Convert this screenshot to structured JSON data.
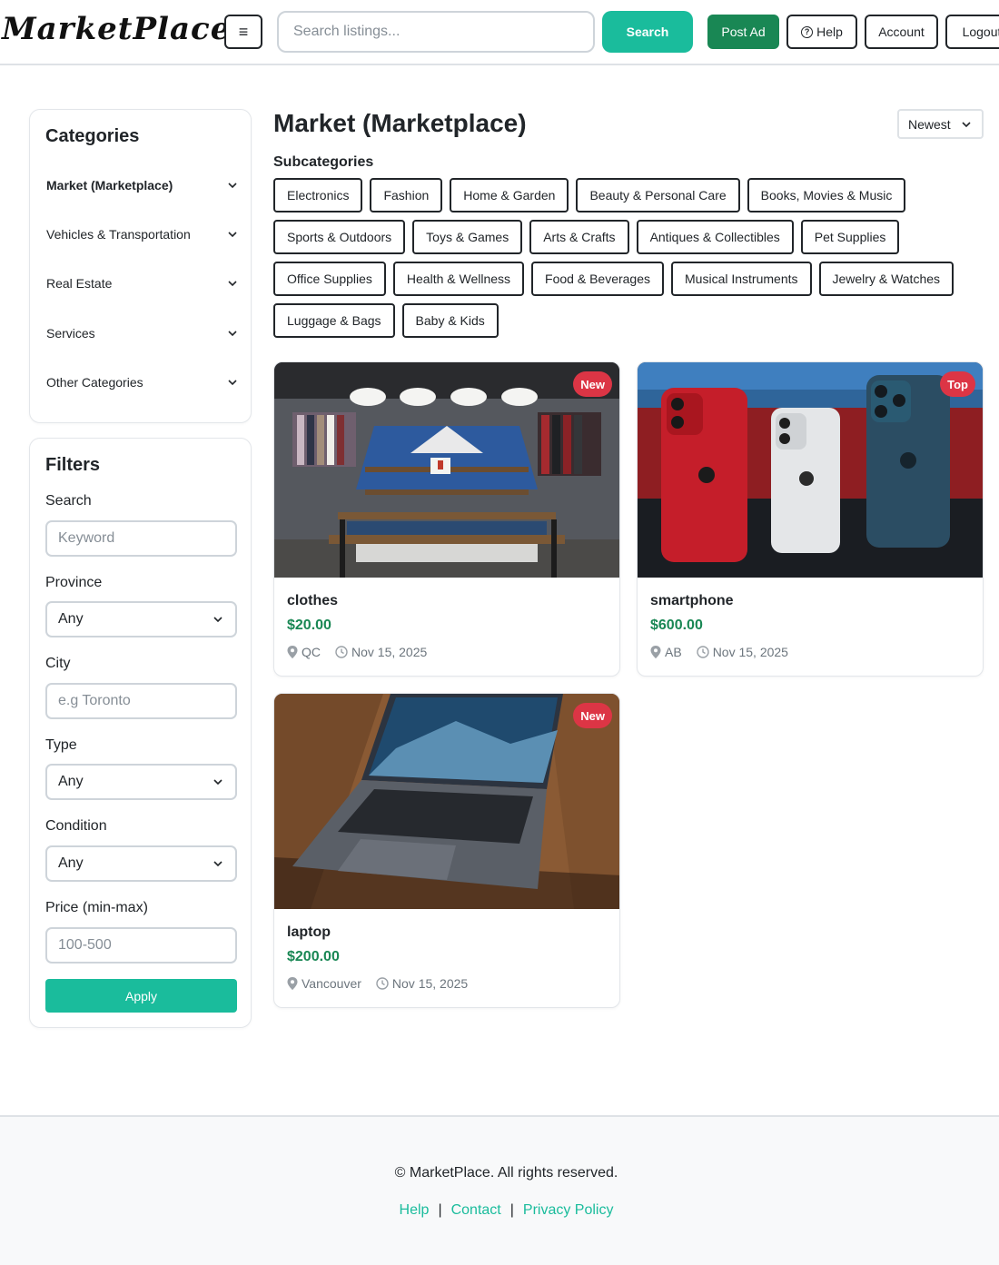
{
  "brand": {
    "logo_text": "MarketPlace"
  },
  "header": {
    "menu_icon": "≡",
    "search_placeholder": "Search listings...",
    "search_button": "Search",
    "post_ad": "Post Ad",
    "help": "Help",
    "account": "Account",
    "logout": "Logout"
  },
  "sidebar": {
    "categories_title": "Categories",
    "categories": [
      {
        "label": "Market (Marketplace)",
        "active": true
      },
      {
        "label": "Vehicles & Transportation",
        "active": false
      },
      {
        "label": "Real Estate",
        "active": false
      },
      {
        "label": "Services",
        "active": false
      },
      {
        "label": "Other Categories",
        "active": false
      }
    ],
    "filters_title": "Filters",
    "filters": {
      "search_label": "Search",
      "search_placeholder": "Keyword",
      "province_label": "Province",
      "province_value": "Any",
      "city_label": "City",
      "city_placeholder": "e.g Toronto",
      "type_label": "Type",
      "type_value": "Any",
      "condition_label": "Condition",
      "condition_value": "Any",
      "price_label": "Price (min-max)",
      "price_placeholder": "100-500",
      "apply_button": "Apply"
    }
  },
  "main": {
    "title": "Market (Marketplace)",
    "sort_value": "Newest",
    "subcategories_title": "Subcategories",
    "subcategories": [
      "Electronics",
      "Fashion",
      "Home & Garden",
      "Beauty & Personal Care",
      "Books, Movies & Music",
      "Sports & Outdoors",
      "Toys & Games",
      "Arts & Crafts",
      "Antiques & Collectibles",
      "Pet Supplies",
      "Office Supplies",
      "Health & Wellness",
      "Food & Beverages",
      "Musical Instruments",
      "Jewelry & Watches",
      "Luggage & Bags",
      "Baby & Kids"
    ],
    "listings": [
      {
        "title": "clothes",
        "price": "$20.00",
        "location": "QC",
        "date": "Nov 15, 2025",
        "badge": "New",
        "image": "clothing-store-photo"
      },
      {
        "title": "smartphone",
        "price": "$600.00",
        "location": "AB",
        "date": "Nov 15, 2025",
        "badge": "Top",
        "image": "smartphones-photo"
      },
      {
        "title": "laptop",
        "price": "$200.00",
        "location": "Vancouver",
        "date": "Nov 15, 2025",
        "badge": "New",
        "image": "laptop-photo"
      }
    ]
  },
  "footer": {
    "copyright": "© MarketPlace. All rights reserved.",
    "links": [
      "Help",
      "Contact",
      "Privacy Policy"
    ]
  },
  "colors": {
    "accent": "#1abc9c",
    "post_ad": "#198754",
    "price": "#198754",
    "badge": "#dc3545"
  }
}
